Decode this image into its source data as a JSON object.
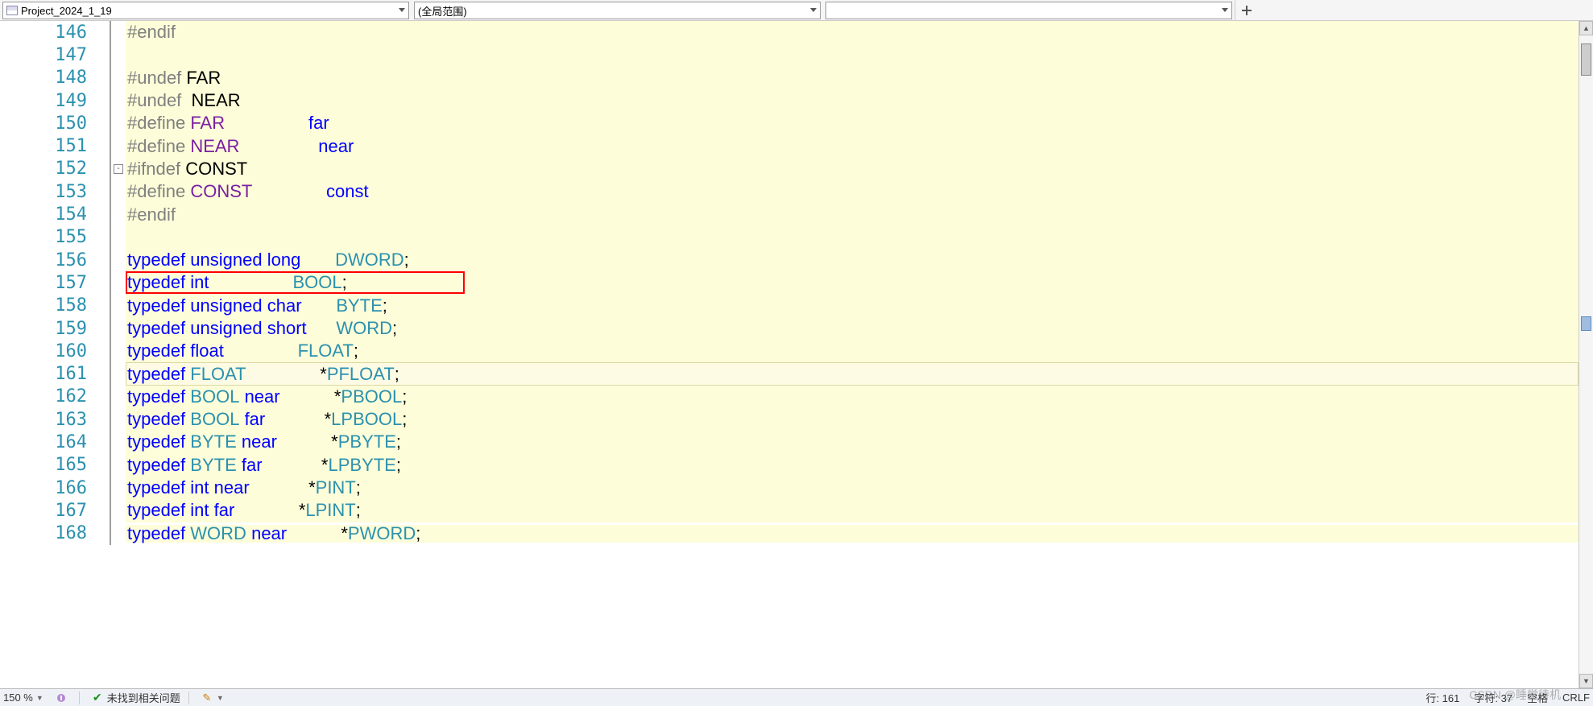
{
  "toolbar": {
    "project_name": "Project_2024_1_19",
    "scope": "(全局范围)",
    "third": ""
  },
  "code": {
    "highlighted_line": 157,
    "current_line": 161,
    "lines": [
      {
        "n": 146,
        "tokens": [
          [
            "pre",
            "#endif"
          ]
        ]
      },
      {
        "n": 147,
        "tokens": []
      },
      {
        "n": 148,
        "tokens": [
          [
            "pre",
            "#undef"
          ],
          [
            "plain",
            " "
          ],
          [
            "plain",
            "FAR"
          ]
        ]
      },
      {
        "n": 149,
        "tokens": [
          [
            "pre",
            "#undef"
          ],
          [
            "plain",
            "  "
          ],
          [
            "plain",
            "NEAR"
          ]
        ]
      },
      {
        "n": 150,
        "tokens": [
          [
            "pre",
            "#define"
          ],
          [
            "plain",
            " "
          ],
          [
            "mac",
            "FAR"
          ],
          [
            "plain",
            "                 "
          ],
          [
            "kw",
            "far"
          ]
        ]
      },
      {
        "n": 151,
        "tokens": [
          [
            "pre",
            "#define"
          ],
          [
            "plain",
            " "
          ],
          [
            "mac",
            "NEAR"
          ],
          [
            "plain",
            "                "
          ],
          [
            "kw",
            "near"
          ]
        ]
      },
      {
        "n": 152,
        "fold": "-",
        "tokens": [
          [
            "pre",
            "#ifndef"
          ],
          [
            "plain",
            " "
          ],
          [
            "plain",
            "CONST"
          ]
        ]
      },
      {
        "n": 153,
        "tokens": [
          [
            "pre",
            "#define"
          ],
          [
            "plain",
            " "
          ],
          [
            "mac",
            "CONST"
          ],
          [
            "plain",
            "               "
          ],
          [
            "kw",
            "const"
          ]
        ]
      },
      {
        "n": 154,
        "tokens": [
          [
            "pre",
            "#endif"
          ]
        ]
      },
      {
        "n": 155,
        "tokens": []
      },
      {
        "n": 156,
        "tokens": [
          [
            "kw",
            "typedef"
          ],
          [
            "plain",
            " "
          ],
          [
            "kw",
            "unsigned"
          ],
          [
            "plain",
            " "
          ],
          [
            "kw",
            "long"
          ],
          [
            "plain",
            "       "
          ],
          [
            "type",
            "DWORD"
          ],
          [
            "plain",
            ";"
          ]
        ]
      },
      {
        "n": 157,
        "tokens": [
          [
            "kw",
            "typedef"
          ],
          [
            "plain",
            " "
          ],
          [
            "kw",
            "int"
          ],
          [
            "plain",
            "                 "
          ],
          [
            "type",
            "BOOL"
          ],
          [
            "plain",
            ";"
          ]
        ]
      },
      {
        "n": 158,
        "tokens": [
          [
            "kw",
            "typedef"
          ],
          [
            "plain",
            " "
          ],
          [
            "kw",
            "unsigned"
          ],
          [
            "plain",
            " "
          ],
          [
            "kw",
            "char"
          ],
          [
            "plain",
            "       "
          ],
          [
            "type",
            "BYTE"
          ],
          [
            "plain",
            ";"
          ]
        ]
      },
      {
        "n": 159,
        "tokens": [
          [
            "kw",
            "typedef"
          ],
          [
            "plain",
            " "
          ],
          [
            "kw",
            "unsigned"
          ],
          [
            "plain",
            " "
          ],
          [
            "kw",
            "short"
          ],
          [
            "plain",
            "      "
          ],
          [
            "type",
            "WORD"
          ],
          [
            "plain",
            ";"
          ]
        ]
      },
      {
        "n": 160,
        "tokens": [
          [
            "kw",
            "typedef"
          ],
          [
            "plain",
            " "
          ],
          [
            "kw",
            "float"
          ],
          [
            "plain",
            "               "
          ],
          [
            "type",
            "FLOAT"
          ],
          [
            "plain",
            ";"
          ]
        ]
      },
      {
        "n": 161,
        "tokens": [
          [
            "kw",
            "typedef"
          ],
          [
            "plain",
            " "
          ],
          [
            "type",
            "FLOAT"
          ],
          [
            "plain",
            "               *"
          ],
          [
            "type",
            "PFLOAT"
          ],
          [
            "plain",
            ";"
          ]
        ]
      },
      {
        "n": 162,
        "tokens": [
          [
            "kw",
            "typedef"
          ],
          [
            "plain",
            " "
          ],
          [
            "type",
            "BOOL"
          ],
          [
            "plain",
            " "
          ],
          [
            "kw",
            "near"
          ],
          [
            "plain",
            "           *"
          ],
          [
            "type",
            "PBOOL"
          ],
          [
            "plain",
            ";"
          ]
        ]
      },
      {
        "n": 163,
        "tokens": [
          [
            "kw",
            "typedef"
          ],
          [
            "plain",
            " "
          ],
          [
            "type",
            "BOOL"
          ],
          [
            "plain",
            " "
          ],
          [
            "kw",
            "far"
          ],
          [
            "plain",
            "            *"
          ],
          [
            "type",
            "LPBOOL"
          ],
          [
            "plain",
            ";"
          ]
        ]
      },
      {
        "n": 164,
        "tokens": [
          [
            "kw",
            "typedef"
          ],
          [
            "plain",
            " "
          ],
          [
            "type",
            "BYTE"
          ],
          [
            "plain",
            " "
          ],
          [
            "kw",
            "near"
          ],
          [
            "plain",
            "           *"
          ],
          [
            "type",
            "PBYTE"
          ],
          [
            "plain",
            ";"
          ]
        ]
      },
      {
        "n": 165,
        "tokens": [
          [
            "kw",
            "typedef"
          ],
          [
            "plain",
            " "
          ],
          [
            "type",
            "BYTE"
          ],
          [
            "plain",
            " "
          ],
          [
            "kw",
            "far"
          ],
          [
            "plain",
            "            *"
          ],
          [
            "type",
            "LPBYTE"
          ],
          [
            "plain",
            ";"
          ]
        ]
      },
      {
        "n": 166,
        "tokens": [
          [
            "kw",
            "typedef"
          ],
          [
            "plain",
            " "
          ],
          [
            "kw",
            "int"
          ],
          [
            "plain",
            " "
          ],
          [
            "kw",
            "near"
          ],
          [
            "plain",
            "            *"
          ],
          [
            "type",
            "PINT"
          ],
          [
            "plain",
            ";"
          ]
        ]
      },
      {
        "n": 167,
        "tokens": [
          [
            "kw",
            "typedef"
          ],
          [
            "plain",
            " "
          ],
          [
            "kw",
            "int"
          ],
          [
            "plain",
            " "
          ],
          [
            "kw",
            "far"
          ],
          [
            "plain",
            "             *"
          ],
          [
            "type",
            "LPINT"
          ],
          [
            "plain",
            ";"
          ]
        ]
      },
      {
        "n": 168,
        "tokens": [
          [
            "kw",
            "typedef"
          ],
          [
            "plain",
            " "
          ],
          [
            "type",
            "WORD"
          ],
          [
            "plain",
            " "
          ],
          [
            "kw",
            "near"
          ],
          [
            "plain",
            "           *"
          ],
          [
            "type",
            "PWORD"
          ],
          [
            "plain",
            ";"
          ]
        ]
      }
    ]
  },
  "status": {
    "zoom": "150 %",
    "issues": "未找到相关问题",
    "line_label": "行: 161",
    "char_label": "字符: 37",
    "indent": "空格",
    "lineend": "CRLF",
    "watermark": "CSDN @睡觉待机"
  }
}
